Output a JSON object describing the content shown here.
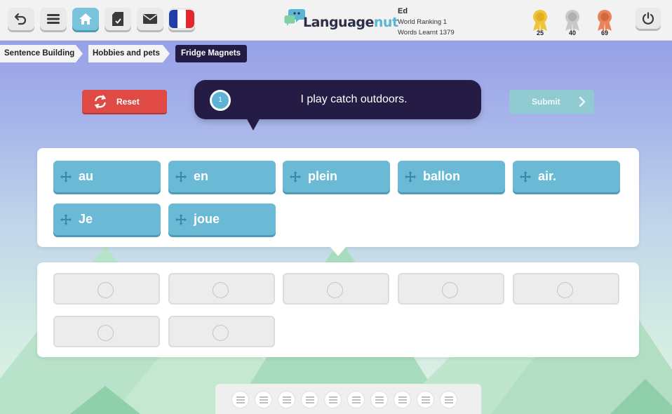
{
  "toolbar": {
    "buttons": [
      {
        "name": "back-icon"
      },
      {
        "name": "menu-icon"
      },
      {
        "name": "home-icon"
      },
      {
        "name": "tasks-icon"
      },
      {
        "name": "mail-icon"
      },
      {
        "name": "france-flag-icon"
      }
    ],
    "accent_color": "#79c3dd"
  },
  "logo": {
    "text_main": "Language",
    "text_accent": "nut"
  },
  "user": {
    "name": "Ed",
    "ranking": "World Ranking 1",
    "words": "Words Learnt 1379"
  },
  "medals": [
    {
      "type": "gold",
      "count": "25",
      "color": "#f0c43a"
    },
    {
      "type": "silver",
      "count": "40",
      "color": "#c8c8c8"
    },
    {
      "type": "bronze",
      "count": "69",
      "color": "#e8835a"
    }
  ],
  "breadcrumbs": [
    {
      "label": "Sentence Building"
    },
    {
      "label": "Hobbies and pets"
    },
    {
      "label": "Fridge Magnets"
    }
  ],
  "controls": {
    "reset_label": "Reset",
    "submit_label": "Submit",
    "reset_color": "#e04a44",
    "submit_color": "#8fcbd0"
  },
  "prompt": {
    "number": "1",
    "text": "I play catch outdoors."
  },
  "word_tiles": [
    "au",
    "en",
    "plein",
    "ballon",
    "air.",
    "Je",
    "joue"
  ],
  "answer_slots": 7,
  "progress_dots": 10
}
